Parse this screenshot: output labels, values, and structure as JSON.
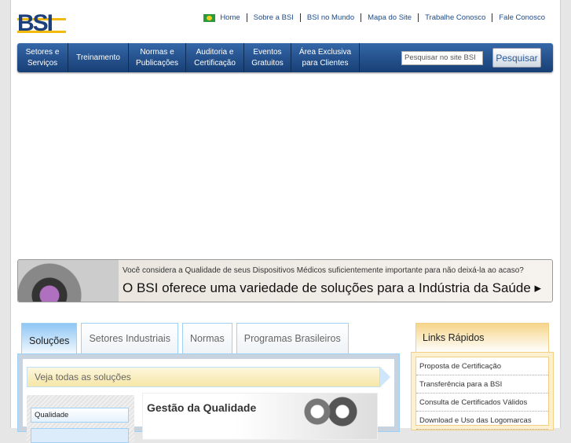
{
  "logo": "BSI",
  "top_links": [
    "Home",
    "Sobre a BSI",
    "BSI no Mundo",
    "Mapa do Site",
    "Trabalhe Conosco",
    "Fale Conosco"
  ],
  "nav": [
    [
      "Setores e",
      "Serviços"
    ],
    [
      "Treinamento"
    ],
    [
      "Normas e",
      "Publicações"
    ],
    [
      "Auditoria e",
      "Certificação"
    ],
    [
      "Eventos",
      "Gratuitos"
    ],
    [
      "Área Exclusiva",
      "para Clientes"
    ]
  ],
  "search": {
    "placeholder": "Pesquisar no site BSI",
    "button": "Pesquisar"
  },
  "banner": {
    "line1": "Você considera a Qualidade de seus Dispositivos Médicos suficientemente importante para não deixá-la ao acaso?",
    "line2": "O BSI oferece uma variedade de soluções para a Indústria da Saúde ▸"
  },
  "tabs": [
    "Soluções",
    "Setores Industriais",
    "Normas",
    "Programas Brasileiros"
  ],
  "panel": {
    "veja": "Veja todas as soluções",
    "side_item": "Qualidade",
    "feature_title": "Gestão da Qualidade"
  },
  "links_rapidos": {
    "title": "Links Rápidos",
    "items": [
      "Proposta de Certificação",
      "Transferência para a BSI",
      "Consulta de Certificados Válidos",
      "Download e Uso das Logomarcas"
    ]
  }
}
